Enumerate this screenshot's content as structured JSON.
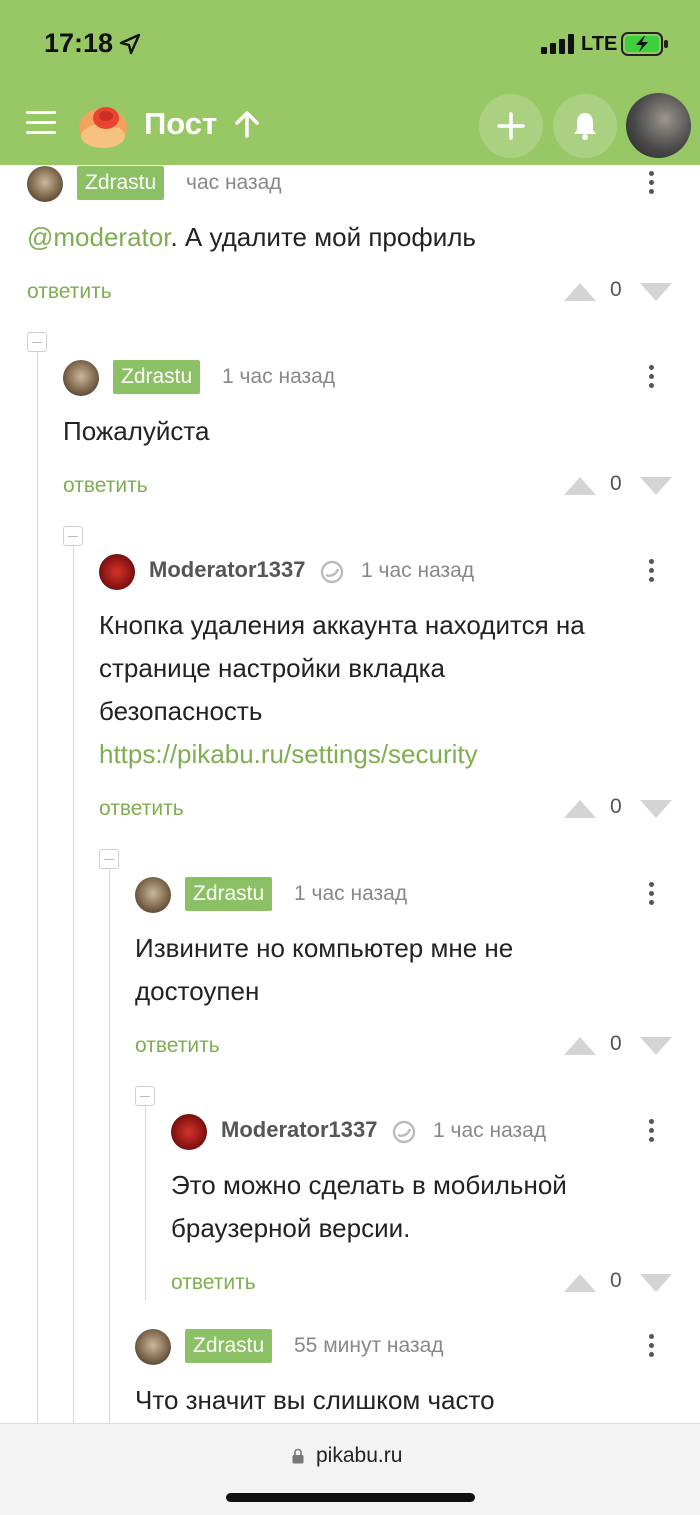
{
  "status_bar": {
    "time": "17:18",
    "network": "LTE"
  },
  "nav": {
    "title": "Пост"
  },
  "comments": [
    {
      "author": "Zdrastu",
      "time": "час назад",
      "mention": "@moderator",
      "text": ". А удалите мой профиль",
      "reply": "ответить",
      "votes": "0"
    },
    {
      "author": "Zdrastu",
      "time": "1 час назад",
      "text": "Пожалуйста",
      "reply": "ответить",
      "votes": "0"
    },
    {
      "author": "Moderator1337",
      "time": "1 час назад",
      "text_lines": [
        "Кнопка удаления аккаунта находится на",
        "странице настройки вкладка",
        "безопасность"
      ],
      "link": "https://pikabu.ru/settings/security",
      "reply": "ответить",
      "votes": "0"
    },
    {
      "author": "Zdrastu",
      "time": "1 час назад",
      "text_lines": [
        "Извините но компьютер мне не",
        "достоупен"
      ],
      "reply": "ответить",
      "votes": "0"
    },
    {
      "author": "Moderator1337",
      "time": "1 час назад",
      "text_lines": [
        "Это можно сделать в мобильной",
        "браузерной версии."
      ],
      "reply": "ответить",
      "votes": "0"
    },
    {
      "author": "Zdrastu",
      "time": "55 минут назад",
      "text": "Что значит вы слишком часто"
    }
  ],
  "browser": {
    "url": "pikabu.ru"
  }
}
